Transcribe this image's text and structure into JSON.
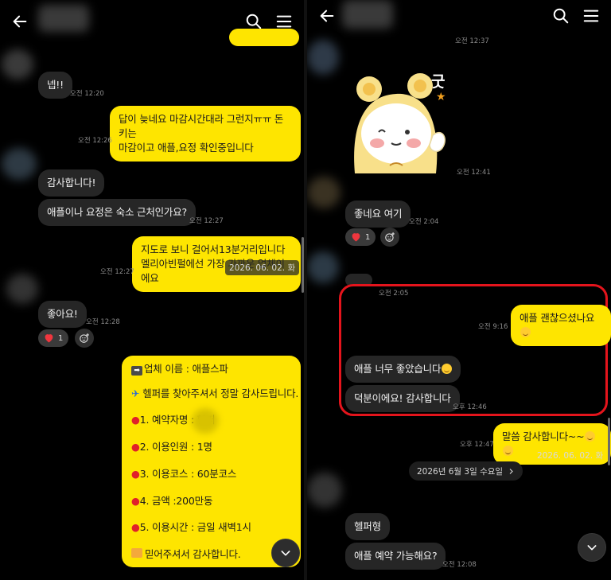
{
  "left": {
    "header": {
      "back_icon": "arrow-left-icon",
      "search_icon": "search-icon",
      "menu_icon": "hamburger-menu-icon"
    },
    "messages": [
      {
        "id": "m1",
        "text": "넵!!",
        "time": "오전 12:20"
      },
      {
        "id": "m2",
        "text": "답이 늦네요 마감시간대라 그런지ㅠㅠ 돈키는\n마감이고 애플,요정 확인중입니다",
        "time": "오전 12:26"
      },
      {
        "id": "m3",
        "text": "감사합니다!"
      },
      {
        "id": "m4",
        "text": "애플이나 요정은 숙소 근처인가요?",
        "time": "오전 12:27"
      },
      {
        "id": "m5",
        "text": "지도로 보니 걸어서13분거리입니다\n멜리아빈펄에선 가장 가까운 업체이에요",
        "time": "오전 12:27"
      },
      {
        "id": "m6",
        "text": "좋아요!",
        "time": "오전 12:28",
        "reaction_count": "1"
      }
    ],
    "date_overlay": "2026. 06. 02. 화",
    "booking": {
      "line1": "업체 이름 : 애플스파",
      "line2": "헬퍼를 찾아주셔서 정말 감사드립니다.",
      "line3": "1. 예약자명 :              헬퍼",
      "line4": "2. 이용인원 :  1명",
      "line5": "3. 이용코스 : 60분코스",
      "line6": "4. 금액 :200만동",
      "line7": "5. 이용시간 : 금일 새벽1시",
      "line8": "믿어주셔서 감사합니다."
    }
  },
  "right": {
    "header": {
      "back_icon": "arrow-left-icon",
      "search_icon": "search-icon",
      "menu_icon": "hamburger-menu-icon"
    },
    "top_time": "오전 12:37",
    "sticker": {
      "text": "굿",
      "time": "오전 12:41"
    },
    "messages": [
      {
        "id": "r1",
        "text": "좋네요 여기",
        "time": "오전 2:04",
        "reaction_count": "1"
      },
      {
        "id": "r2",
        "text": "애플 괜찮으셨나요",
        "time": "오전 9:16"
      },
      {
        "id": "r3",
        "text": "애플 너무 좋았습니다"
      },
      {
        "id": "r4",
        "text": "덕분이에요! 감사합니다",
        "time": "오후 12:46"
      },
      {
        "id": "r5",
        "text": "말씀 감사합니다~~",
        "time": "오후 12:47"
      },
      {
        "id": "r6",
        "text": "헬퍼형"
      },
      {
        "id": "r7",
        "text": "애플 예약 가능해요?",
        "time": "오전 12:08"
      }
    ],
    "partial_time": "오전 2:05",
    "date_overlay": "2026. 06. 02. 화",
    "date_divider": "2026년 6월 3일 수요일"
  },
  "colors": {
    "accent": "#fee500",
    "bubble_dark": "#262626",
    "highlight": "#e4141c",
    "background": "#000000"
  }
}
